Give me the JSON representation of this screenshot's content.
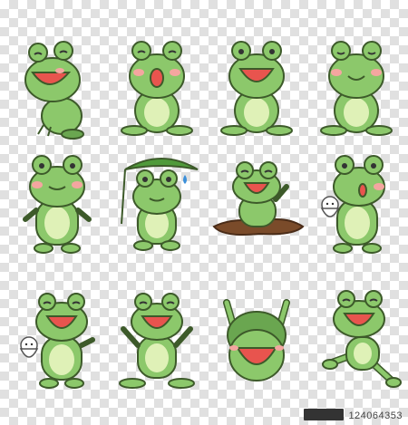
{
  "sheet": {
    "type": "frog sticker set",
    "rows": 3,
    "columns": 4
  },
  "palette": {
    "skin": "#8cc86b",
    "skin_dark": "#6aa650",
    "belly": "#dff1b7",
    "mouth": "#e8544e",
    "cheek": "#f4a6a0",
    "leaf": "#4f9a3a",
    "mud": "#7a4b2a",
    "drop": "#3b8fd9",
    "outline": "#3d5a2a"
  },
  "frogs": [
    {
      "pose": "sitting-laughing"
    },
    {
      "pose": "sitting-open-mouth"
    },
    {
      "pose": "sitting-big-smile"
    },
    {
      "pose": "sitting-calm"
    },
    {
      "pose": "standing"
    },
    {
      "pose": "holding-leaf-umbrella"
    },
    {
      "pose": "in-mud-puddle"
    },
    {
      "pose": "holding-teru-teru-bozu"
    },
    {
      "pose": "holding-teru-teru-bozu-laughing"
    },
    {
      "pose": "cheering-arms-up"
    },
    {
      "pose": "arms-up-shout"
    },
    {
      "pose": "leaning-kick"
    }
  ],
  "watermark": {
    "id": "124064353"
  }
}
